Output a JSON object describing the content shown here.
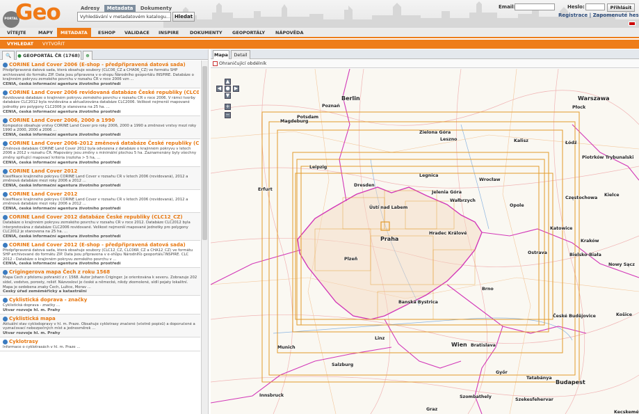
{
  "header": {
    "logo_small": "PORTAL",
    "logo_big": "Geo",
    "tabs": [
      "Adresy",
      "Metadata",
      "Dokumenty"
    ],
    "active_tab": "Metadata",
    "search_placeholder": "Vyhledávání v metadatovém katalogu...",
    "search_button": "Hledat",
    "email_label": "Email:",
    "password_label": "Heslo:",
    "login_button": "Přihlásit",
    "register_link": "Registrace",
    "forgot_link": "Zapomenuté heslo"
  },
  "nav": {
    "items": [
      "VÍTEJTE",
      "MAPY",
      "METADATA",
      "ESHOP",
      "VALIDACE",
      "INSPIRE",
      "DOKUMENTY",
      "GEOPORTÁLY",
      "NÁPOVĚDA"
    ],
    "active": "METADATA"
  },
  "subnav": {
    "items": [
      "VYHLEDAT",
      "VYTVOŘIT"
    ]
  },
  "left": {
    "tab_label": "GEOPORTÁL ČR (1768)",
    "items": [
      {
        "title": "CORINE Land Cover 2006 (E-shop - předpřipravená datová sada)",
        "desc": "Předpřipravená datová sada, která obsahuje soubory (CLC06_CZ a CHA06_CZ) ve formátu SHP archivované do formátu ZIP. Data jsou připravena v e-shopu Národního geoportálu INSPIRE. Databáze o krajinném pokryvu zemského povrchu v rozsahu ČR v roce 2006 vzn ...",
        "org": "CENIA, česká informační agentura životního prostředí"
      },
      {
        "title": "CORINE Land Cover 2006 revidovaná databáze České republiky (CLC06R_CZ)",
        "desc": "Revidovaná databáze o krajinném pokryvu zemského povrchu v rozsahu ČR v roce 2006. V rámci tvorby databáze CLC2012 byla revidována a aktualizována databáze CLC2006. Velikost nejmenší mapované jednotky pro polygony CLC2006 je stanovena na 25 ha. ...",
        "org": "CENIA, česká informační agentura životního prostředí"
      },
      {
        "title": "CORINE Land Cover 2006, 2000 a 1990",
        "desc": "Kompozice obsahuje vrstvy CORINE Land Cover pro roky 2006, 2000 a 1990 a změnové vrstvy mezi roky 1990 a 2000, 2000 a 2006 ...",
        "org": "CENIA, česká informační agentura životního prostředí"
      },
      {
        "title": "CORINE Land Cover 2006-2012 změnová databáze České republiky (CHA12_CZ)",
        "desc": "Změnová databáze CORINE Land Cover 2012 byla odvozena z databáze o krajinném pokryvu v letech 2006 a 2012 v rozsahu ČR. Mapovány jsou změny s minimální plochou 5 ha. Zaznamenány byly všechny změny splňující mapovací kritéria (rozloha > 5 ha, ...",
        "org": "CENIA, česká informační agentura životního prostředí"
      },
      {
        "title": "CORINE Land Cover 2012",
        "desc": "Klasifikace krajinného pokryvu CORINE Land Cover v rozsahu ČR v letech 2006 (revidovaná), 2012 a změnová databáze mezi roky 2006 a 2012 ...",
        "org": "CENIA, česká informační agentura životního prostředí"
      },
      {
        "title": "CORINE Land Cover 2012",
        "desc": "Klasifikace krajinného pokryvu CORINE Land Cover v rozsahu ČR v letech 2006 (revidovaná), 2012 a změnová databáze mezi roky 2006 a 2012 ...",
        "org": "CENIA, česká informační agentura životního prostředí"
      },
      {
        "title": "CORINE Land Cover 2012 databáze České republiky (CLC12_CZ)",
        "desc": "Databáze o krajinném pokryvu zemského povrchu v rozsahu ČR v roce 2012. Databáze CLC2012 byla interpretována z databáze CLC2006 revidované. Velikost nejmenší mapované jednotky pro polygony CLC2012 je stanovena na 25 ha. ...",
        "org": "CENIA, česká informační agentura životního prostředí"
      },
      {
        "title": "CORINE Land Cover 2012 (E-shop - předpřipravená datová sada)",
        "desc": "Předpřipravená datová sada, která obsahuje soubory (CLC12_CZ, CLC06R_CZ a CHA12_CZ) ve formátu SHP archivované do formátu ZIP. Data jsou připravena v e-shopu Národního geoportálu INSPIRE. CLC 2012 - Databáze o krajinném pokryvu zemského povrchu v ...",
        "org": "CENIA, česká informační agentura životního prostředí"
      },
      {
        "title": "Crigingerova mapa Čech z roku 1568",
        "desc": "Mapa Čech z přelomu pohraničí z r. 1568. Autor Johann Criginger. Je orientována k severu. Zobrazuje 202 sídel, vodstvo, porosty, reliéf. Názvoslovi je české a německé, nikdy zkomolené, sídlí pojaty lokalitní. Mapa je ozdobena znaky Čech, Lužice, Morav ...",
        "org": "Český úřad zeměměřický a katastrální"
      },
      {
        "title": "Cyklistická doprava - značky",
        "desc": "Cyklistická doprava - značky ...",
        "org": "Útvar rozvoje hl. m. Prahy"
      },
      {
        "title": "Cyklistická mapa",
        "desc": "Aktuální stav cyklodopravy v hl. m. Praze. Obsahuje cyklotrasy značené (včetně popisů) a doporučené a vyznačovací nebezpečných míst a jednosměrek ...",
        "org": "Útvar rozvoje hl. m. Prahy"
      },
      {
        "title": "Cyklotrasy",
        "desc": "Informace o cyklotrasách v hl. m. Praze ...",
        "org": ""
      }
    ]
  },
  "map": {
    "tabs": [
      "Mapa",
      "Detail"
    ],
    "active_tab": "Mapa",
    "toolbar_label": "Ohraničující obdélník",
    "cities": [
      "Berlin",
      "Warszawa",
      "Poznań",
      "Płock",
      "Potsdam",
      "Magdeburg",
      "Zielona Góra",
      "Leszno",
      "Kalisz",
      "Łódź",
      "Piotrków Trybunalski",
      "Leipzig",
      "Legnica",
      "Wrocław",
      "Kielce",
      "Erfurt",
      "Dresden",
      "Częstochowa",
      "Jelenia Góra",
      "Ústí nad Labem",
      "Wałbrzych",
      "Opole",
      "Katowice",
      "Praha",
      "Hradec Králové",
      "Kraków",
      "Nowy Sącz",
      "Ostrava",
      "Bielsko-Biała",
      "Plzeň",
      "Brno",
      "Banská Bystrica",
      "České Budějovice",
      "Košice",
      "Linz",
      "Wien",
      "Bratislava",
      "Munich",
      "Salzburg",
      "Győr",
      "Budapest",
      "Tatabánya",
      "Innsbruck",
      "Szombathely",
      "Szekesfehervar",
      "Graz",
      "Kecskemét"
    ]
  }
}
